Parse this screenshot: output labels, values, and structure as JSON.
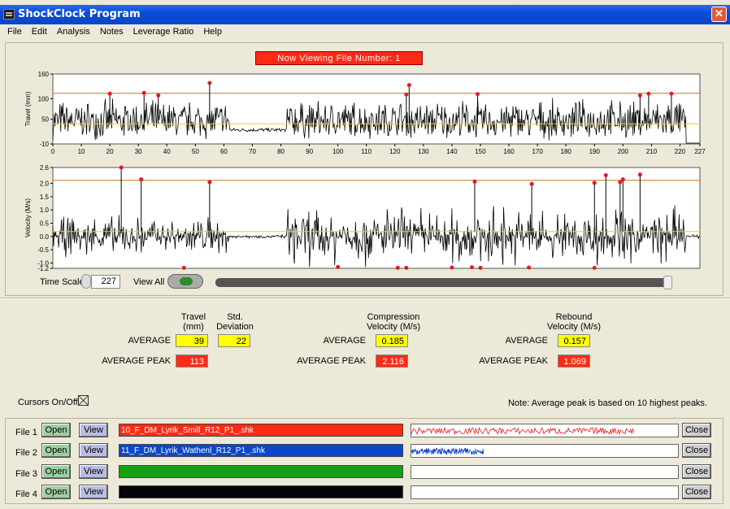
{
  "window": {
    "title": "ShockClock  Program",
    "close_glyph": "✕"
  },
  "menu": [
    "File",
    "Edit",
    "Analysis",
    "Notes",
    "Leverage Ratio",
    "Help"
  ],
  "banner": "Now  Viewing  File  Number:    1",
  "chart_data": [
    {
      "type": "line",
      "ylabel": "Travel (mm)",
      "ylim": [
        -10,
        160
      ],
      "xlim": [
        0,
        227
      ],
      "yticks": [
        "160",
        "100",
        "50",
        "-10"
      ],
      "xticks": [
        "0",
        "10",
        "20",
        "30",
        "40",
        "50",
        "60",
        "70",
        "80",
        "90",
        "100",
        "110",
        "120",
        "130",
        "140",
        "150",
        "160",
        "170",
        "180",
        "190",
        "200",
        "210",
        "220",
        "227"
      ],
      "average_line": 39,
      "average_peak_line": 113,
      "peaks": [
        [
          20,
          112
        ],
        [
          32,
          114
        ],
        [
          37,
          108
        ],
        [
          55,
          138
        ],
        [
          124,
          110
        ],
        [
          125,
          133
        ],
        [
          149,
          111
        ],
        [
          206,
          108
        ],
        [
          209,
          112
        ],
        [
          217,
          112
        ]
      ],
      "colors": {
        "series": "#000000",
        "average": "#e6d800",
        "peak_line": "#c07a20",
        "peak": "#e41a1c"
      }
    },
    {
      "type": "line",
      "ylabel": "Velocity (M/s)",
      "ylim": [
        -1.2,
        2.6
      ],
      "xlim": [
        0,
        227
      ],
      "yticks": [
        "2.6",
        "2.0",
        "1.5",
        "1.0",
        "0.5",
        "0.0",
        "-0.5",
        "-1.0",
        "-1.2"
      ],
      "average_line": 0.185,
      "average_peak_line": 2.116,
      "peaks": [
        [
          24,
          2.6
        ],
        [
          31,
          2.15
        ],
        [
          55,
          2.05
        ],
        [
          148,
          2.07
        ],
        [
          168,
          1.98
        ],
        [
          190,
          2.02
        ],
        [
          194,
          2.31
        ],
        [
          199,
          2.05
        ],
        [
          200,
          2.15
        ],
        [
          206,
          2.33
        ]
      ],
      "low_peaks": [
        [
          46,
          -1.18
        ],
        [
          100,
          -1.15
        ],
        [
          121,
          -1.18
        ],
        [
          124,
          -1.18
        ],
        [
          140,
          -1.17
        ],
        [
          147,
          -1.16
        ],
        [
          150,
          -1.18
        ],
        [
          167,
          -1.17
        ],
        [
          190,
          -1.18
        ]
      ],
      "colors": {
        "series": "#000000",
        "average": "#e6d800",
        "peak_line": "#c07a20",
        "peak": "#e41a1c"
      }
    }
  ],
  "controls": {
    "time_scale_label": "Time Scale",
    "time_scale_value": "227",
    "view_all_label": "View All"
  },
  "stats": {
    "travel_header": "Travel\n(mm)",
    "std_header": "Std.\nDeviation",
    "comp_header": "Compression\nVelocity (M/s)",
    "reb_header": "Rebound\nVelocity (M/s)",
    "average_label": "AVERAGE",
    "avg_peak_label": "AVERAGE PEAK",
    "travel_avg": "39",
    "std_dev": "22",
    "travel_peak": "113",
    "comp_avg": "0.185",
    "comp_peak": "2.116",
    "reb_avg": "0.157",
    "reb_peak": "1.069"
  },
  "cursors_label": "Cursors On/Off",
  "note": "Note:  Average peak is based on 10 highest peaks.",
  "files": [
    {
      "label": "File 1",
      "name": "10_F_DM_Lyrik_Smill_R12_P1_.shk",
      "color": "#ff2a14",
      "preview_color": "#e41a1c",
      "preview_extent": 0.83
    },
    {
      "label": "File 2",
      "name": "11_F_DM_Lyrik_Wathenl_R12_P1_.shk",
      "color": "#0a48c8",
      "preview_color": "#1a4ac8",
      "preview_extent": 0.27
    },
    {
      "label": "File 3",
      "name": "",
      "color": "#14a014",
      "preview_color": "",
      "preview_extent": 0
    },
    {
      "label": "File 4",
      "name": "",
      "color": "#050505",
      "preview_color": "",
      "preview_extent": 0
    }
  ],
  "buttons": {
    "open": "Open",
    "view": "View",
    "close": "Close"
  }
}
